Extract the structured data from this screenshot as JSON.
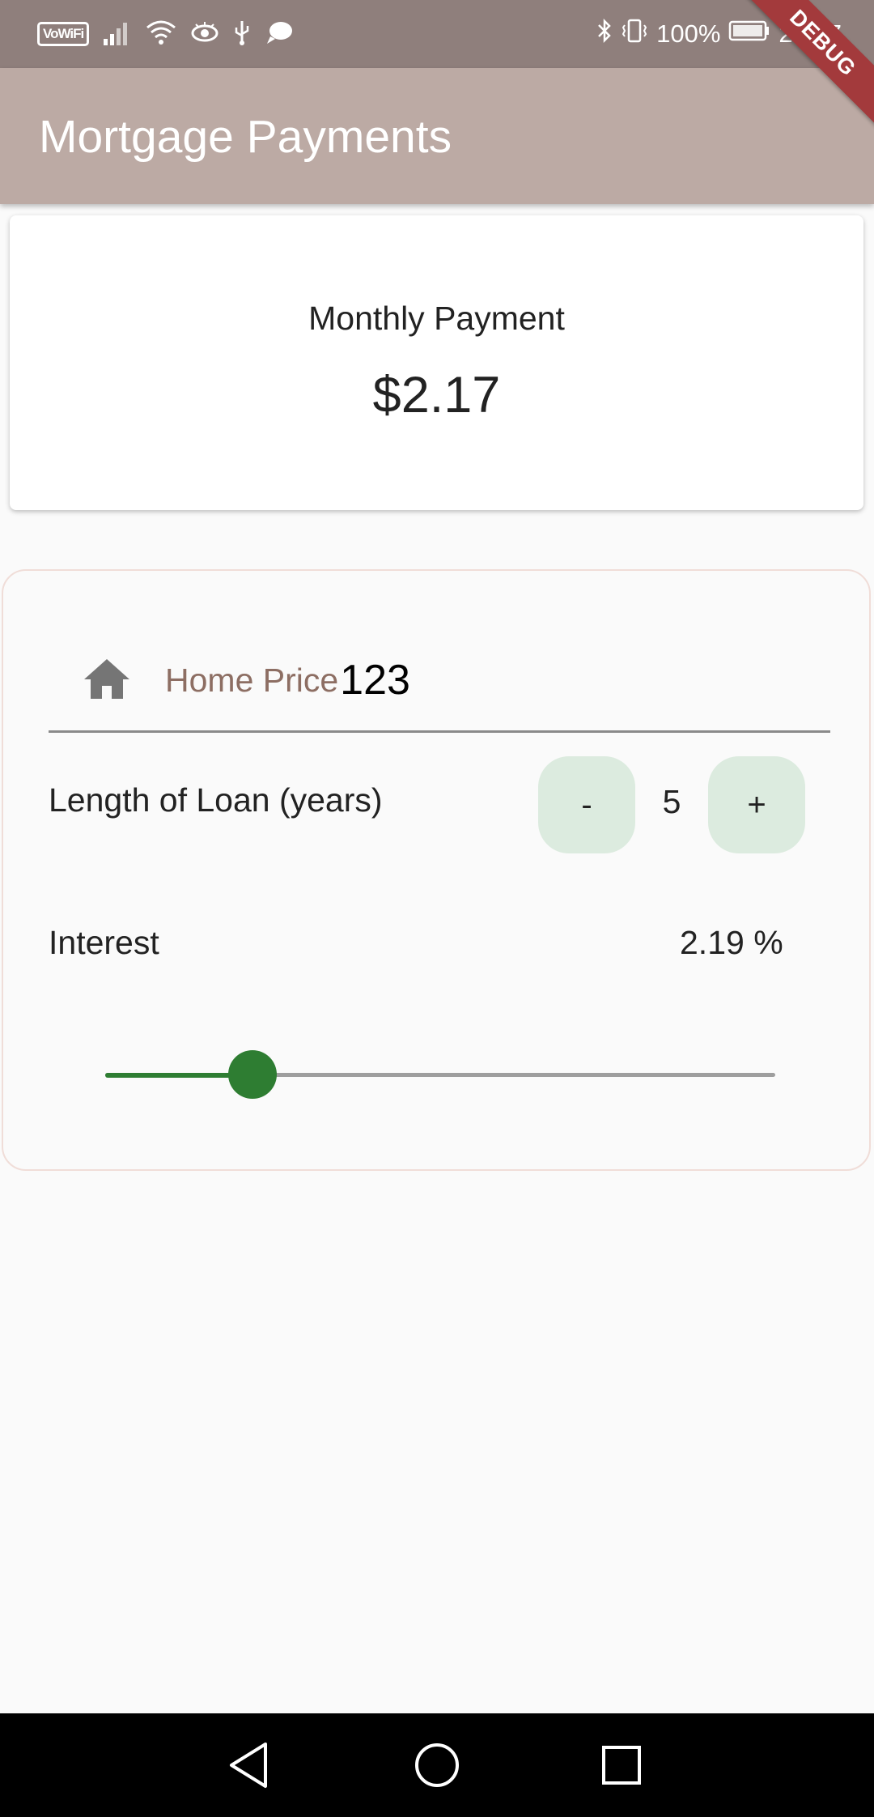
{
  "status_bar": {
    "carrier_badge": "VoWiFi",
    "battery": "100%",
    "time": "23:27",
    "icons": [
      "vowifi-icon",
      "signal-icon",
      "wifi-icon",
      "eye-icon",
      "usb-icon",
      "chat-icon",
      "bluetooth-icon",
      "vibrate-icon",
      "battery-icon"
    ]
  },
  "debug_banner": "DEBUG",
  "app_bar": {
    "title": "Mortgage Payments"
  },
  "payment_card": {
    "label": "Monthly Payment",
    "value": "$2.17"
  },
  "form": {
    "home_price": {
      "label": "Home Price",
      "value": "123",
      "icon": "home-icon"
    },
    "loan_length": {
      "label": "Length of Loan (years)",
      "decrement": "-",
      "value": "5",
      "increment": "+"
    },
    "interest": {
      "label": "Interest",
      "value": "2.19 %",
      "slider_fraction": 0.22
    }
  },
  "colors": {
    "status_bar": "#8f7f7c",
    "app_bar": "#bcaaa4",
    "accent_green": "#2e7d32",
    "stepper_bg": "#dcebdf",
    "label_brown": "#8d6e63",
    "background": "#fafafa"
  },
  "nav_bar": {
    "icons": [
      "back-icon",
      "home-circle-icon",
      "recents-icon"
    ]
  }
}
